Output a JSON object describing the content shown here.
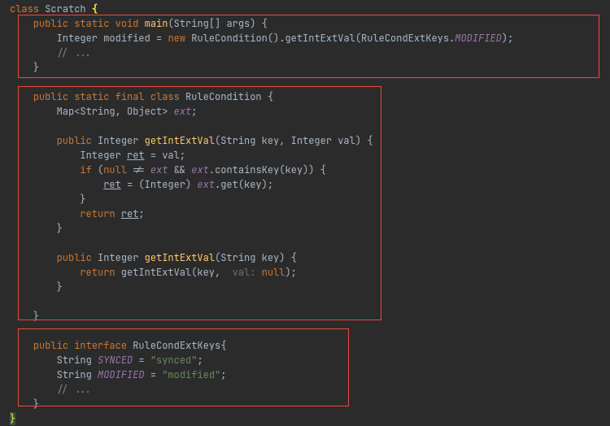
{
  "code": {
    "l0_class": "class",
    "l0_name": "Scratch",
    "l0_brace": "{",
    "l1_mods": "public static void",
    "l1_fn": "main",
    "l1_sig": "(String[] args) {",
    "l2_type": "Integer",
    "l2_var": "modified",
    "l2_eq": " = ",
    "l2_new": "new",
    "l2_ctor": " RuleCondition().",
    "l2_call": "getIntExtVal",
    "l2_arg_a": "(RuleCondExtKeys.",
    "l2_field": "MODIFIED",
    "l2_arg_b": ");",
    "l3_comment": "// ...",
    "l4_brace": "}",
    "l5_mods": "public static final class",
    "l5_name": "RuleCondition",
    "l5_brace": " {",
    "l6_type": "Map<String, Object> ",
    "l6_field": "ext",
    "l6_semi": ";",
    "l7_mod": "public",
    "l7_ret": " Integer ",
    "l7_fn": "getIntExtVal",
    "l7_sig": "(String key, Integer val) {",
    "l8_a": "Integer ",
    "l8_var": "ret",
    "l8_b": " = val;",
    "l9_a": "if",
    "l9_b": " (",
    "l9_c": "null",
    "l9_d": " != ",
    "l9_ext1": "ext",
    "l9_e": " && ",
    "l9_ext2": "ext",
    "l9_f": ".containsKey(key)) {",
    "l10_var": "ret",
    "l10_a": " = (Integer) ",
    "l10_ext": "ext",
    "l10_b": ".get(key);",
    "l11_brace": "}",
    "l12_a": "return ",
    "l12_var": "ret",
    "l12_b": ";",
    "l13_brace": "}",
    "l14_mod": "public",
    "l14_ret": " Integer ",
    "l14_fn": "getIntExtVal",
    "l14_sig": "(String key) {",
    "l15_a": "return",
    "l15_b": " getIntExtVal(key, ",
    "l15_hint": " val: ",
    "l15_c": "null",
    "l15_d": ");",
    "l16_brace": "}",
    "l17_brace": "}",
    "l18_a": "public interface",
    "l18_name": " RuleCondExtKeys",
    "l18_brace": "{",
    "l19_a": "String ",
    "l19_field": "SYNCED",
    "l19_b": " = ",
    "l19_str": "\"synced\"",
    "l19_c": ";",
    "l20_a": "String ",
    "l20_field": "MODIFIED",
    "l20_b": " = ",
    "l20_str": "\"modified\"",
    "l20_c": ";",
    "l21_comment": "// ...",
    "l22_brace": "}",
    "l23_brace": "}"
  }
}
